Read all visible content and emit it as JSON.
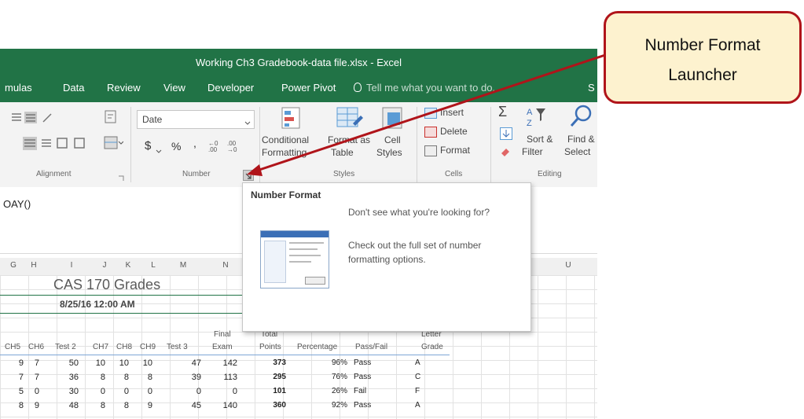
{
  "window": {
    "title": "Working Ch3 Gradebook-data file.xlsx - Excel"
  },
  "tabs": [
    {
      "label": "mulas"
    },
    {
      "label": "Data"
    },
    {
      "label": "Review"
    },
    {
      "label": "View"
    },
    {
      "label": "Developer"
    },
    {
      "label": "Power Pivot"
    },
    {
      "label": "Tell me what you want to do..."
    },
    {
      "label": "S"
    }
  ],
  "ribbon": {
    "alignment_label": "Alignment",
    "number_label": "Number",
    "styles_label": "Styles",
    "cells_label": "Cells",
    "editing_label": "Editing",
    "number_format_value": "Date",
    "currency_symbol": "$",
    "percent_symbol": "%",
    "comma_symbol": ",",
    "cond_fmt_line1": "Conditional",
    "cond_fmt_line2": "Formatting",
    "format_table_line1": "Format as",
    "format_table_line2": "Table",
    "cell_styles_line1": "Cell",
    "cell_styles_line2": "Styles",
    "insert_label": "Insert",
    "delete_label": "Delete",
    "format_label": "Format",
    "sort_line1": "Sort &",
    "sort_line2": "Filter",
    "find_line1": "Find &",
    "find_line2": "Select"
  },
  "formula_bar": {
    "text": "OAY()"
  },
  "columns": [
    "G",
    "H",
    "I",
    "J",
    "K",
    "L",
    "M",
    "N",
    "U"
  ],
  "sheet": {
    "title": "CAS 170 Grades",
    "date": "8/25/16 12:00 AM",
    "headers": {
      "ch5": "CH5",
      "ch6": "CH6",
      "test2": "Test 2",
      "ch7": "CH7",
      "ch8": "CH8",
      "ch9": "CH9",
      "test3": "Test 3",
      "final_exam_1": "Final",
      "final_exam_2": "Exam",
      "total_points_1": "Total",
      "total_points_2": "Points",
      "percentage": "Percentage",
      "pass_fail": "Pass/Fail",
      "letter_grade_1": "Letter",
      "letter_grade_2": "Grade"
    },
    "rows": [
      {
        "ch5": "9",
        "ch6": "7",
        "test2": "50",
        "ch7": "10",
        "ch8": "10",
        "ch9": "10",
        "test3": "47",
        "final": "142",
        "total": "373",
        "pct": "96%",
        "pf": "Pass",
        "grade": "A"
      },
      {
        "ch5": "7",
        "ch6": "7",
        "test2": "36",
        "ch7": "8",
        "ch8": "8",
        "ch9": "8",
        "test3": "39",
        "final": "113",
        "total": "295",
        "pct": "76%",
        "pf": "Pass",
        "grade": "C"
      },
      {
        "ch5": "5",
        "ch6": "0",
        "test2": "30",
        "ch7": "0",
        "ch8": "0",
        "ch9": "0",
        "test3": "0",
        "final": "0",
        "total": "101",
        "pct": "26%",
        "pf": "Fail",
        "grade": "F"
      },
      {
        "ch5": "8",
        "ch6": "9",
        "test2": "48",
        "ch7": "8",
        "ch8": "8",
        "ch9": "9",
        "test3": "45",
        "final": "140",
        "total": "360",
        "pct": "92%",
        "pf": "Pass",
        "grade": "A"
      }
    ]
  },
  "tooltip": {
    "title": "Number Format",
    "line1": "Don't see what you're looking for?",
    "line2": "Check out the full set of number formatting options."
  },
  "callout": {
    "line1": "Number Format",
    "line2": "Launcher"
  },
  "colors": {
    "excel_green": "#217346",
    "callout_fill": "#fdf2cf",
    "callout_border": "#b0141a",
    "arrow": "#b0141a"
  }
}
